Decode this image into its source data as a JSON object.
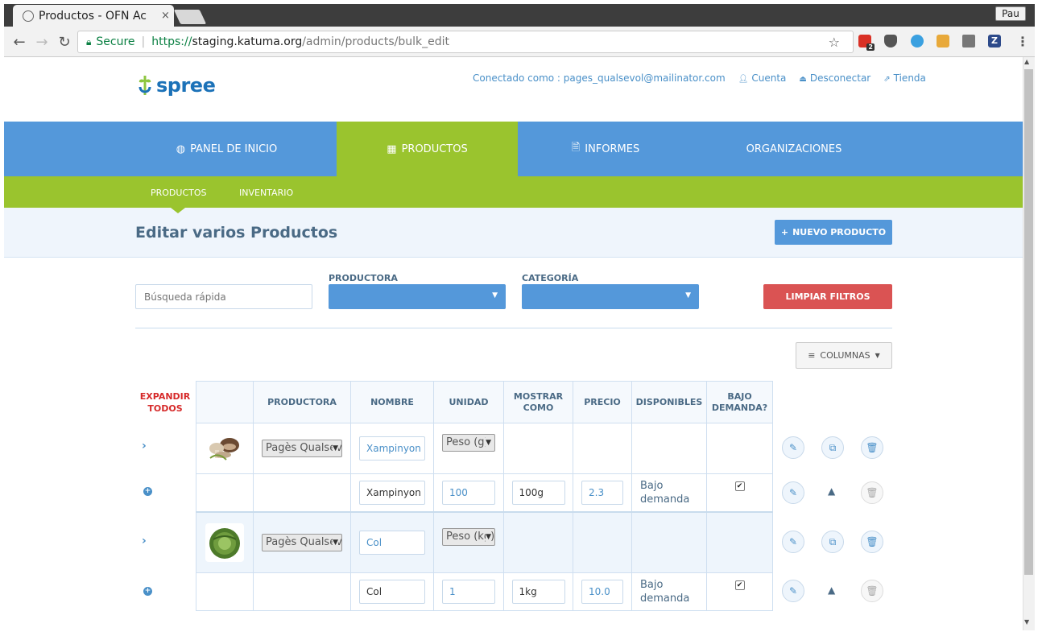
{
  "browser": {
    "tab_title": "Productos - OFN Ac",
    "tab_close": "×",
    "profile": "Pau",
    "secure_label": "Secure",
    "url_scheme": "https://",
    "url_host": "staging.katuma.org",
    "url_path": "/admin/products/bulk_edit",
    "extension_badge": "2"
  },
  "header": {
    "logo_text": "spree",
    "logged_in_as": "Conectado como : pages_qualsevol@mailinator.com",
    "account": "Cuenta",
    "logout": "Desconectar",
    "store": "Tienda"
  },
  "mainnav": {
    "items": [
      {
        "label": "PANEL DE INICIO",
        "icon": "dashboard-icon"
      },
      {
        "label": "PRODUCTOS",
        "icon": "grid-icon",
        "active": true
      },
      {
        "label": "INFORMES",
        "icon": "file-icon"
      },
      {
        "label": "ORGANIZACIONES",
        "icon": ""
      }
    ]
  },
  "subnav": {
    "items": [
      "PRODUCTOS",
      "INVENTARIO"
    ]
  },
  "page": {
    "title": "Editar varios Productos",
    "new_product": "NUEVO PRODUCTO"
  },
  "filters": {
    "search_placeholder": "Búsqueda rápida",
    "producer_label": "PRODUCTORA",
    "category_label": "CATEGORÍA",
    "clear": "LIMPIAR FILTROS",
    "columns": "COLUMNAS"
  },
  "table": {
    "expand_all": "EXPANDIR TODOS",
    "headers": {
      "productora": "PRODUCTORA",
      "nombre": "NOMBRE",
      "unidad": "UNIDAD",
      "mostrar": "MOSTRAR COMO",
      "precio": "PRECIO",
      "disponibles": "DISPONIBLES",
      "bajo": "BAJO DEMANDA?"
    },
    "products": [
      {
        "producer": "Pagès Qualsevol",
        "name": "Xampinyon",
        "unit": "Peso (g)",
        "image": "mushrooms",
        "variant": {
          "name": "Xampinyon",
          "unit_value": "100",
          "display_as": "100g",
          "price": "2.3",
          "on_hand": "Bajo demanda",
          "on_demand": true
        }
      },
      {
        "producer": "Pagès Qualsevol",
        "name": "Col",
        "unit": "Peso (kg)",
        "image": "cabbage",
        "variant": {
          "name": "Col",
          "unit_value": "1",
          "display_as": "1kg",
          "price": "10.0",
          "on_hand": "Bajo demanda",
          "on_demand": true
        }
      }
    ]
  },
  "colors": {
    "nav_blue": "#5498da",
    "nav_green": "#9ac42e",
    "danger": "#da5353"
  }
}
